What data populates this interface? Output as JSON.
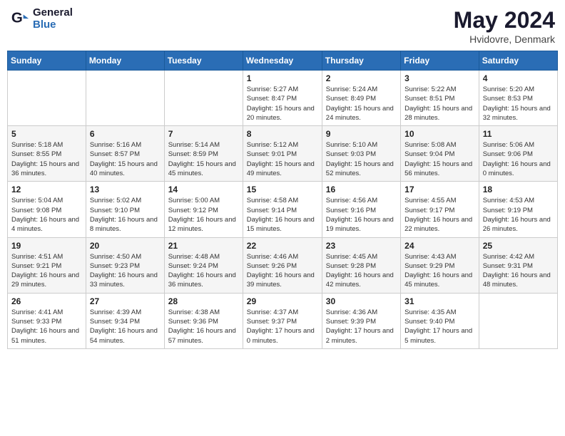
{
  "header": {
    "logo_line1": "General",
    "logo_line2": "Blue",
    "month": "May 2024",
    "location": "Hvidovre, Denmark"
  },
  "days_of_week": [
    "Sunday",
    "Monday",
    "Tuesday",
    "Wednesday",
    "Thursday",
    "Friday",
    "Saturday"
  ],
  "weeks": [
    [
      {
        "day": "",
        "info": ""
      },
      {
        "day": "",
        "info": ""
      },
      {
        "day": "",
        "info": ""
      },
      {
        "day": "1",
        "info": "Sunrise: 5:27 AM\nSunset: 8:47 PM\nDaylight: 15 hours\nand 20 minutes."
      },
      {
        "day": "2",
        "info": "Sunrise: 5:24 AM\nSunset: 8:49 PM\nDaylight: 15 hours\nand 24 minutes."
      },
      {
        "day": "3",
        "info": "Sunrise: 5:22 AM\nSunset: 8:51 PM\nDaylight: 15 hours\nand 28 minutes."
      },
      {
        "day": "4",
        "info": "Sunrise: 5:20 AM\nSunset: 8:53 PM\nDaylight: 15 hours\nand 32 minutes."
      }
    ],
    [
      {
        "day": "5",
        "info": "Sunrise: 5:18 AM\nSunset: 8:55 PM\nDaylight: 15 hours\nand 36 minutes."
      },
      {
        "day": "6",
        "info": "Sunrise: 5:16 AM\nSunset: 8:57 PM\nDaylight: 15 hours\nand 40 minutes."
      },
      {
        "day": "7",
        "info": "Sunrise: 5:14 AM\nSunset: 8:59 PM\nDaylight: 15 hours\nand 45 minutes."
      },
      {
        "day": "8",
        "info": "Sunrise: 5:12 AM\nSunset: 9:01 PM\nDaylight: 15 hours\nand 49 minutes."
      },
      {
        "day": "9",
        "info": "Sunrise: 5:10 AM\nSunset: 9:03 PM\nDaylight: 15 hours\nand 52 minutes."
      },
      {
        "day": "10",
        "info": "Sunrise: 5:08 AM\nSunset: 9:04 PM\nDaylight: 15 hours\nand 56 minutes."
      },
      {
        "day": "11",
        "info": "Sunrise: 5:06 AM\nSunset: 9:06 PM\nDaylight: 16 hours\nand 0 minutes."
      }
    ],
    [
      {
        "day": "12",
        "info": "Sunrise: 5:04 AM\nSunset: 9:08 PM\nDaylight: 16 hours\nand 4 minutes."
      },
      {
        "day": "13",
        "info": "Sunrise: 5:02 AM\nSunset: 9:10 PM\nDaylight: 16 hours\nand 8 minutes."
      },
      {
        "day": "14",
        "info": "Sunrise: 5:00 AM\nSunset: 9:12 PM\nDaylight: 16 hours\nand 12 minutes."
      },
      {
        "day": "15",
        "info": "Sunrise: 4:58 AM\nSunset: 9:14 PM\nDaylight: 16 hours\nand 15 minutes."
      },
      {
        "day": "16",
        "info": "Sunrise: 4:56 AM\nSunset: 9:16 PM\nDaylight: 16 hours\nand 19 minutes."
      },
      {
        "day": "17",
        "info": "Sunrise: 4:55 AM\nSunset: 9:17 PM\nDaylight: 16 hours\nand 22 minutes."
      },
      {
        "day": "18",
        "info": "Sunrise: 4:53 AM\nSunset: 9:19 PM\nDaylight: 16 hours\nand 26 minutes."
      }
    ],
    [
      {
        "day": "19",
        "info": "Sunrise: 4:51 AM\nSunset: 9:21 PM\nDaylight: 16 hours\nand 29 minutes."
      },
      {
        "day": "20",
        "info": "Sunrise: 4:50 AM\nSunset: 9:23 PM\nDaylight: 16 hours\nand 33 minutes."
      },
      {
        "day": "21",
        "info": "Sunrise: 4:48 AM\nSunset: 9:24 PM\nDaylight: 16 hours\nand 36 minutes."
      },
      {
        "day": "22",
        "info": "Sunrise: 4:46 AM\nSunset: 9:26 PM\nDaylight: 16 hours\nand 39 minutes."
      },
      {
        "day": "23",
        "info": "Sunrise: 4:45 AM\nSunset: 9:28 PM\nDaylight: 16 hours\nand 42 minutes."
      },
      {
        "day": "24",
        "info": "Sunrise: 4:43 AM\nSunset: 9:29 PM\nDaylight: 16 hours\nand 45 minutes."
      },
      {
        "day": "25",
        "info": "Sunrise: 4:42 AM\nSunset: 9:31 PM\nDaylight: 16 hours\nand 48 minutes."
      }
    ],
    [
      {
        "day": "26",
        "info": "Sunrise: 4:41 AM\nSunset: 9:33 PM\nDaylight: 16 hours\nand 51 minutes."
      },
      {
        "day": "27",
        "info": "Sunrise: 4:39 AM\nSunset: 9:34 PM\nDaylight: 16 hours\nand 54 minutes."
      },
      {
        "day": "28",
        "info": "Sunrise: 4:38 AM\nSunset: 9:36 PM\nDaylight: 16 hours\nand 57 minutes."
      },
      {
        "day": "29",
        "info": "Sunrise: 4:37 AM\nSunset: 9:37 PM\nDaylight: 17 hours\nand 0 minutes."
      },
      {
        "day": "30",
        "info": "Sunrise: 4:36 AM\nSunset: 9:39 PM\nDaylight: 17 hours\nand 2 minutes."
      },
      {
        "day": "31",
        "info": "Sunrise: 4:35 AM\nSunset: 9:40 PM\nDaylight: 17 hours\nand 5 minutes."
      },
      {
        "day": "",
        "info": ""
      }
    ]
  ]
}
